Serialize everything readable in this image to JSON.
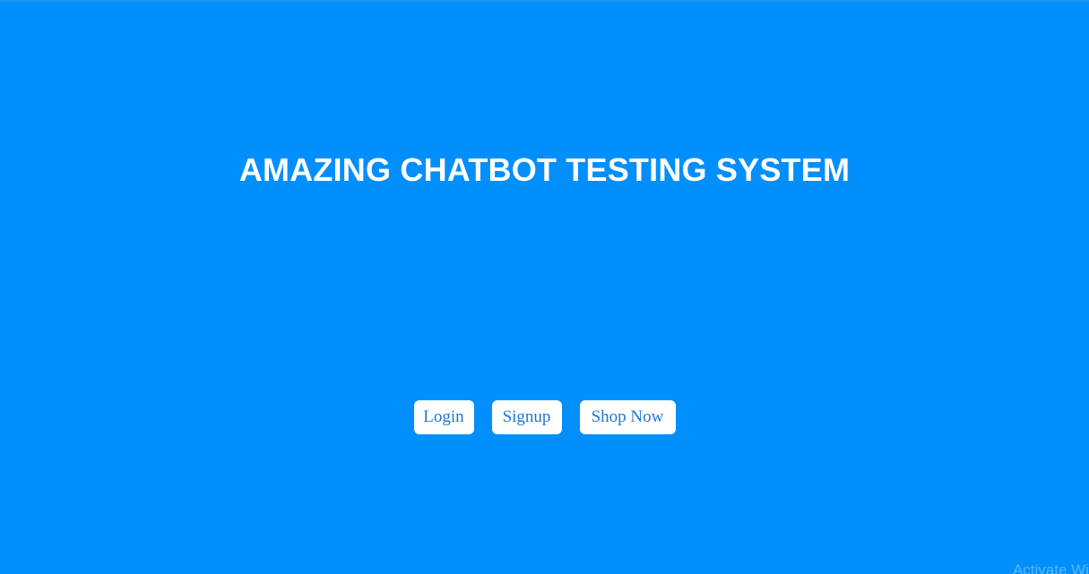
{
  "page": {
    "background_color": "#008ffc"
  },
  "hero": {
    "title": "AMAZING CHATBOT TESTING SYSTEM"
  },
  "actions": {
    "login_label": "Login",
    "signup_label": "Signup",
    "shop_label": "Shop Now",
    "button_text_color": "#1f78d1",
    "button_bg_color": "#ffffff"
  },
  "os_overlay": {
    "watermark_text": "Activate Wi"
  }
}
